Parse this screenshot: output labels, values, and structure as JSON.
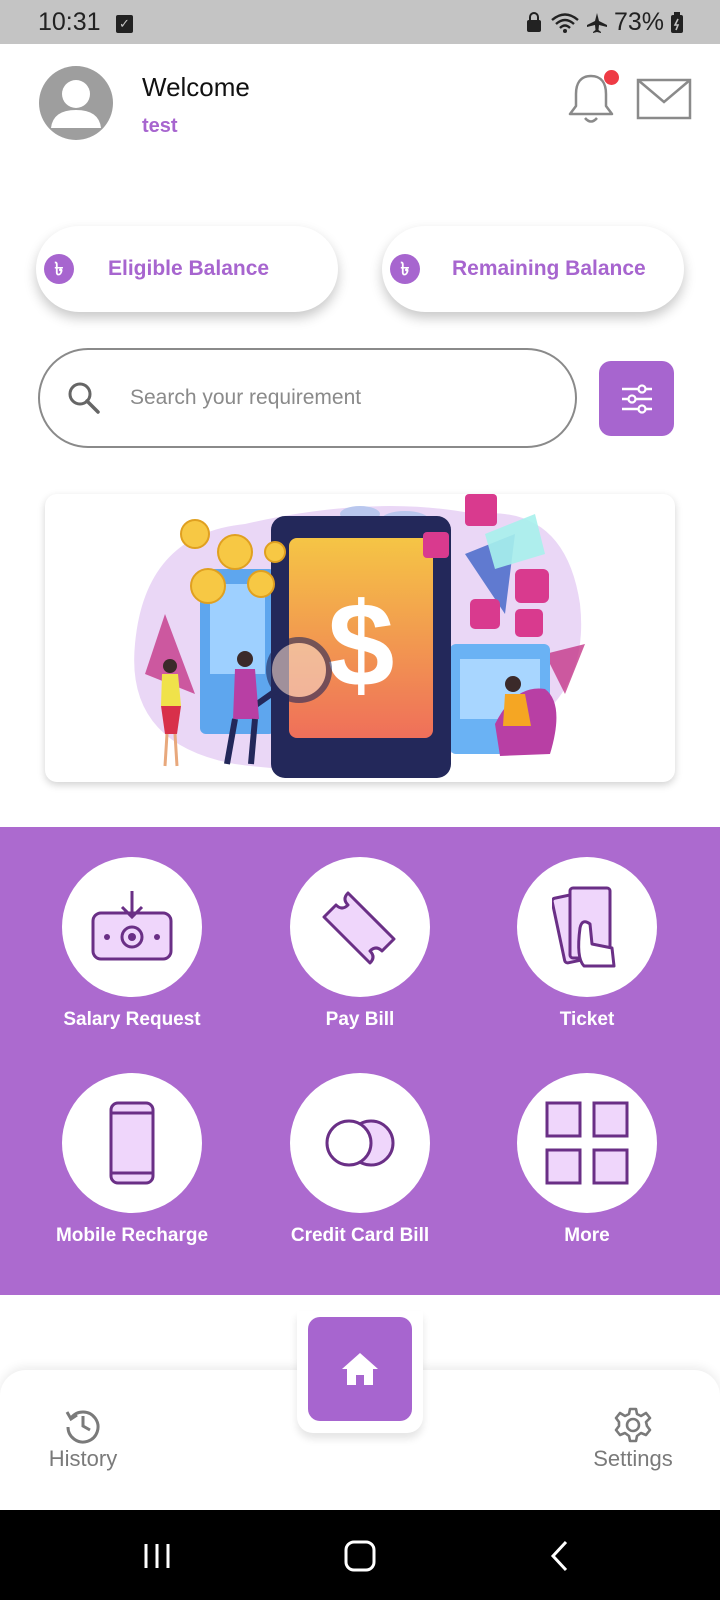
{
  "status_bar": {
    "time": "10:31",
    "battery": "73%"
  },
  "header": {
    "welcome": "Welcome",
    "username": "test"
  },
  "balances": [
    {
      "label": "Eligible Balance",
      "icon": "taka-icon"
    },
    {
      "label": "Remaining Balance",
      "icon": "taka-icon"
    }
  ],
  "search": {
    "placeholder": "Search your requirement"
  },
  "services": [
    {
      "label": "Salary Request",
      "icon": "salary-request-icon"
    },
    {
      "label": "Pay Bill",
      "icon": "pay-bill-icon"
    },
    {
      "label": "Ticket",
      "icon": "ticket-icon"
    },
    {
      "label": "Mobile Recharge",
      "icon": "mobile-recharge-icon"
    },
    {
      "label": "Credit Card Bill",
      "icon": "credit-card-bill-icon"
    },
    {
      "label": "More",
      "icon": "more-grid-icon"
    }
  ],
  "bottom_nav": {
    "history": "History",
    "settings": "Settings",
    "home_icon": "home-icon"
  },
  "colors": {
    "accent": "#a765cf",
    "services_bg": "#ac6acf",
    "notification": "#ee3b45"
  }
}
